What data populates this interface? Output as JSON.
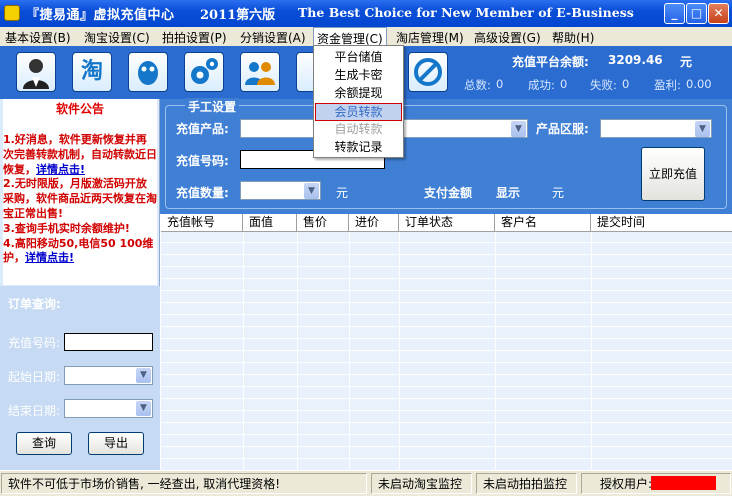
{
  "window": {
    "title": "『捷易通』虚拟充值中心",
    "version": "2011第六版",
    "slogan": "The Best Choice for New Member of E-Business",
    "min": "_",
    "max": "□",
    "close": "✕"
  },
  "menubar": {
    "items": [
      "基本设置(B)",
      "淘宝设置(C)",
      "拍拍设置(P)",
      "分销设置(A)",
      "资金管理(C)",
      "淘店管理(M)",
      "高级设置(G)",
      "帮助(H)"
    ],
    "active": "资金管理(C)"
  },
  "dropdown": {
    "items": [
      "平台储值",
      "生成卡密",
      "余额提现",
      "会员转款",
      "自动转款",
      "转款记录"
    ],
    "selected": "会员转款",
    "disabled": "自动转款"
  },
  "toolbar": {
    "icons": [
      "user-icon",
      "taobao-icon",
      "qq-icon",
      "settings-icon",
      "members-icon",
      "cancel-icon"
    ],
    "taobao_glyph": "淘",
    "balance_label": "充值平台余额:",
    "balance_value": "3209.46",
    "balance_unit": "元",
    "stats": {
      "total_label": "总数:",
      "total": "0",
      "success_label": "成功:",
      "success": "0",
      "fail_label": "失败:",
      "fail": "0",
      "profit_label": "盈利:",
      "profit": "0.00"
    }
  },
  "notice": {
    "title": "软件公告",
    "lines": [
      {
        "text": "1.好消息，软件更新恢复并再次完善转款机制，自动转款近日恢复，",
        "link": "详情点击!"
      },
      {
        "text": "2.无时限版，月版激活码开放采购，软件商品近两天恢复在淘宝正常出售!",
        "link": ""
      },
      {
        "text": "3.查询手机实时余额维护!",
        "link": ""
      },
      {
        "text": "4.高阳移动50,电信50 100维护，",
        "link": "详情点击!"
      }
    ]
  },
  "order_query": {
    "title": "订单查询:",
    "phone_label": "充值号码:",
    "start_label": "起始日期:",
    "end_label": "结束日期:",
    "query_button": "查询",
    "export_button": "导出"
  },
  "manual": {
    "title": "手工设置",
    "product_label": "充值产品:",
    "region_label": "产品区服:",
    "number_label": "充值号码:",
    "qty_label": "充值数量:",
    "qty_unit": "元",
    "pay_label": "支付金额",
    "pay_value": "显示",
    "pay_unit": "元",
    "recharge_button": "立即充值"
  },
  "grid": {
    "columns": [
      "充值帐号",
      "面值",
      "售价",
      "进价",
      "订单状态",
      "客户名",
      "提交时间"
    ]
  },
  "statusbar": {
    "message": "软件不可低于市场价销售, 一经查出, 取消代理资格!",
    "taobao_monitor": "未启动淘宝监控",
    "paipai_monitor": "未启动拍拍监控",
    "auth_label": "授权用户:"
  }
}
